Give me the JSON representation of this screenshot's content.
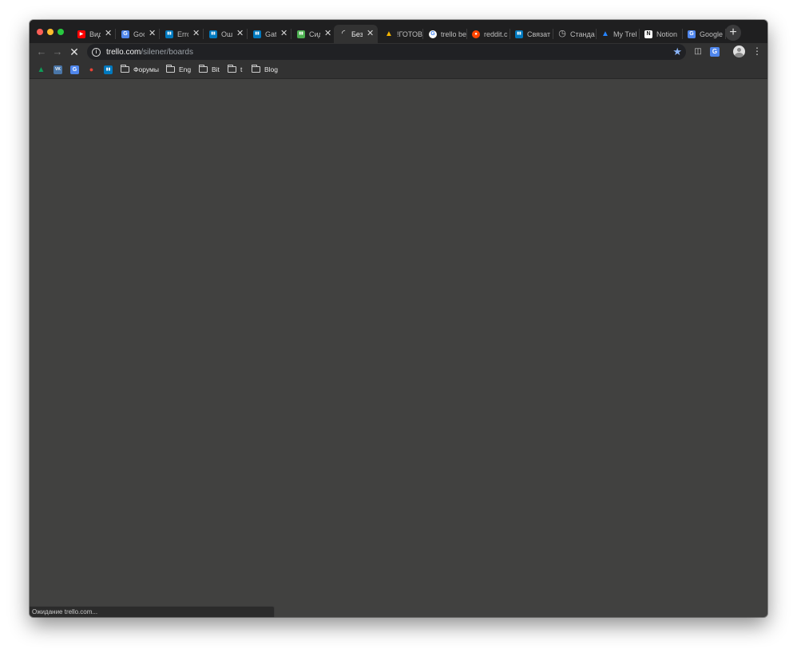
{
  "window": {
    "traffic_lights": [
      "close",
      "minimize",
      "maximize"
    ]
  },
  "tabs": [
    {
      "title": "Вид",
      "icon": "youtube-icon",
      "color": "#ff0000",
      "glyph": "▶"
    },
    {
      "title": "Goo",
      "icon": "google-docs-icon",
      "color": "#4f86ec",
      "glyph": "G"
    },
    {
      "title": "Erro",
      "icon": "trello-icon",
      "color": "#0079bf",
      "glyph": "▮▮"
    },
    {
      "title": "Ош",
      "icon": "trello-icon",
      "color": "#0079bf",
      "glyph": "▮▮"
    },
    {
      "title": "Gat",
      "icon": "trello-icon",
      "color": "#0079bf",
      "glyph": "▮▮"
    },
    {
      "title": "Сид",
      "icon": "trello-icon",
      "color": "#4caf50",
      "glyph": "▮▮"
    },
    {
      "title": "Без",
      "icon": "loading-spinner-icon",
      "color": "#e8e8e8",
      "glyph": "◜",
      "active": true
    },
    {
      "title": "!ГОТОВ",
      "icon": "google-drive-icon",
      "color": "#f4b400",
      "glyph": "▲"
    },
    {
      "title": "trello be",
      "icon": "google-icon",
      "color": "#ffffff",
      "glyph": "G"
    },
    {
      "title": "reddit.c",
      "icon": "reddit-icon",
      "color": "#ff4500",
      "glyph": "●"
    },
    {
      "title": "Связат",
      "icon": "trello-icon",
      "color": "#0079bf",
      "glyph": "▮▮"
    },
    {
      "title": "Станда",
      "icon": "clock-icon",
      "color": "#9aa0a6",
      "glyph": "◷"
    },
    {
      "title": "My Trel",
      "icon": "atlassian-icon",
      "color": "#2684ff",
      "glyph": "▲"
    },
    {
      "title": "Notion",
      "icon": "notion-icon",
      "color": "#ffffff",
      "glyph": "N"
    },
    {
      "title": "Google",
      "icon": "google-translate-icon",
      "color": "#4f86ec",
      "glyph": "G"
    }
  ],
  "toolbar": {
    "url_host": "trello.com",
    "url_path": "/silener/boards",
    "stop_glyph": "✕",
    "back_glyph": "←",
    "forward_glyph": "→"
  },
  "bookmarks": [
    {
      "type": "site",
      "icon": "google-drive-icon",
      "color": "#0f9d58",
      "glyph": "▲"
    },
    {
      "type": "site",
      "icon": "vk-icon",
      "color": "#4a76a8",
      "glyph": "VK"
    },
    {
      "type": "site",
      "icon": "google-docs-icon",
      "color": "#4f86ec",
      "glyph": "G"
    },
    {
      "type": "site",
      "icon": "maps-pin-icon",
      "color": "#ea4335",
      "glyph": "●"
    },
    {
      "type": "site",
      "icon": "trello-icon",
      "color": "#0079bf",
      "glyph": "▮▮"
    },
    {
      "type": "folder",
      "label": "Форумы"
    },
    {
      "type": "folder",
      "label": "Eng"
    },
    {
      "type": "folder",
      "label": "Bit"
    },
    {
      "type": "folder",
      "label": "t"
    },
    {
      "type": "folder",
      "label": "Blog"
    }
  ],
  "status": {
    "text": "Ожидание trello.com..."
  },
  "colors": {
    "tabstrip": "#1f1f20",
    "toolbar": "#323232",
    "content": "#414140",
    "bookmark_star": "#8ab4f8"
  }
}
